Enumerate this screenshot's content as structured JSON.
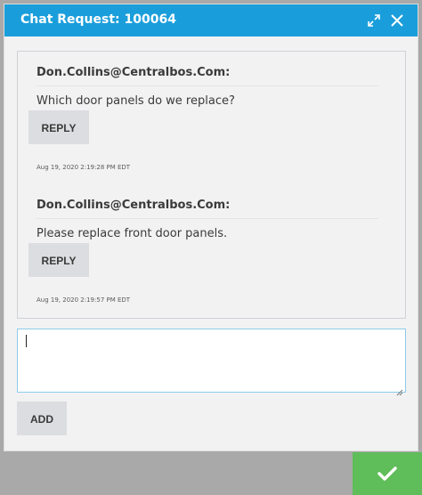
{
  "header": {
    "title": "Chat Request: 100064",
    "icons": [
      "expand-icon",
      "close-icon"
    ],
    "color": "#1a9edb"
  },
  "messages": [
    {
      "author": "Don.Collins@Centralbos.Com:",
      "text": "Which door panels do we replace?",
      "reply_label": "REPLY",
      "timestamp": "Aug 19, 2020 2:19:28 PM EDT"
    },
    {
      "author": "Don.Collins@Centralbos.Com:",
      "text": "Please replace front door panels.",
      "reply_label": "REPLY",
      "timestamp": "Aug 19, 2020 2:19:57 PM EDT"
    }
  ],
  "composer": {
    "value": "",
    "add_label": "ADD"
  },
  "footer": {
    "confirm_icon": "checkmark-icon",
    "confirm_color": "#5fbd5a"
  }
}
